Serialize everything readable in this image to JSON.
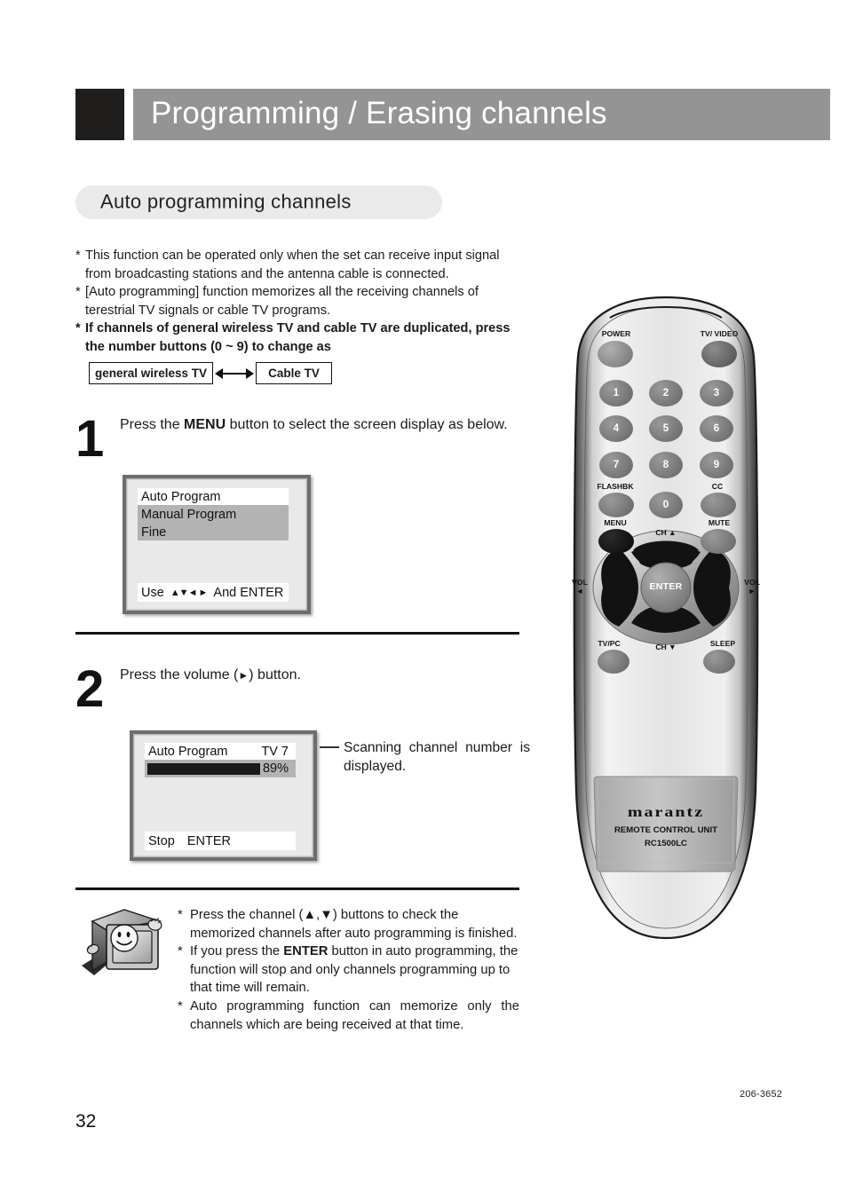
{
  "header": {
    "title": "Programming / Erasing channels"
  },
  "section": {
    "title": "Auto programming channels"
  },
  "intro": {
    "notes": [
      {
        "marker": "*",
        "text": "This function can be operated only when the set can receive input signal from broadcasting stations and the antenna cable is connected.",
        "bold": false
      },
      {
        "marker": "*",
        "text": "[Auto programming] function memorizes all the receiving channels of terestrial TV signals or cable TV programs.",
        "bold": false
      },
      {
        "marker": "*",
        "text": "If channels of general wireless TV and cable TV are duplicated, press the number buttons (0 ~ 9) to change as",
        "bold": true
      }
    ],
    "swap": {
      "left_label": "general wireless TV",
      "right_label": "Cable TV",
      "arrow_icon": "double-arrow-icon"
    }
  },
  "steps": [
    {
      "number": "1",
      "instruction_pre": "Press the ",
      "instruction_bold": "MENU",
      "instruction_post": " button to select the screen display as below.",
      "osd": {
        "item_selected": "Auto  Program",
        "item_2": "Manual  Program",
        "item_3": "Fine",
        "footer_pre": "Use",
        "footer_arrows": "▲▼◄ ►",
        "footer_post": "And ENTER"
      }
    },
    {
      "number": "2",
      "instruction_pre": "Press the volume (",
      "instruction_icon": "►",
      "instruction_post": ") button.",
      "osd": {
        "title": "Auto  Program",
        "channel": "TV 7",
        "progress_label": "89%",
        "progress_value": 89,
        "footer_stop": "Stop",
        "footer_enter": "ENTER"
      },
      "callout": "Scanning channel number is displayed."
    }
  ],
  "bottom_notes": {
    "icon": "tv-mascot-icon",
    "items": [
      {
        "marker": "*",
        "pre": "Press the channel (▲,▼) buttons to check the memorized channels after auto programming is finished.",
        "bold_word": "",
        "post": ""
      },
      {
        "marker": "*",
        "pre": "If you press the ",
        "bold_word": "ENTER",
        "post": " button in auto programming, the function will stop and only channels programming up to that time will remain."
      },
      {
        "marker": "*",
        "pre": "Auto programming function can memorize only the channels which are being received at that time.",
        "bold_word": "",
        "post": ""
      }
    ]
  },
  "footer": {
    "page_number": "32",
    "doc_number": "206-3652"
  },
  "remote": {
    "brand": "marantz",
    "brand_line1": "REMOTE CONTROL UNIT",
    "brand_line2": "RC1500LC",
    "labels": {
      "power": "POWER",
      "tv_video": "TV/ VIDEO",
      "flashbk": "FLASHBK",
      "cc": "CC",
      "menu": "MENU",
      "mute": "MUTE",
      "ch_up": "CH ▲",
      "ch_down": "CH ▼",
      "vol_left": "VOL",
      "vol_left_arrow": "◄",
      "vol_right": "VOL",
      "vol_right_arrow": "►",
      "tv_pc": "TV/PC",
      "sleep": "SLEEP",
      "enter": "ENTER"
    },
    "numbers": [
      "1",
      "2",
      "3",
      "4",
      "5",
      "6",
      "7",
      "8",
      "9",
      "0"
    ]
  },
  "colors": {
    "header_bar": "#949494",
    "header_square": "#201d1d",
    "pill_bg": "#eaeaea",
    "osd_bg": "#e9e9e9",
    "osd_highlight": "#b3b3b3",
    "osd_border": "#6d6d6d",
    "progress_fill": "#1a1a1a",
    "remote_body": "#d9d9d9",
    "remote_button": "#8a8a8a",
    "remote_button_dark": "#111111"
  }
}
